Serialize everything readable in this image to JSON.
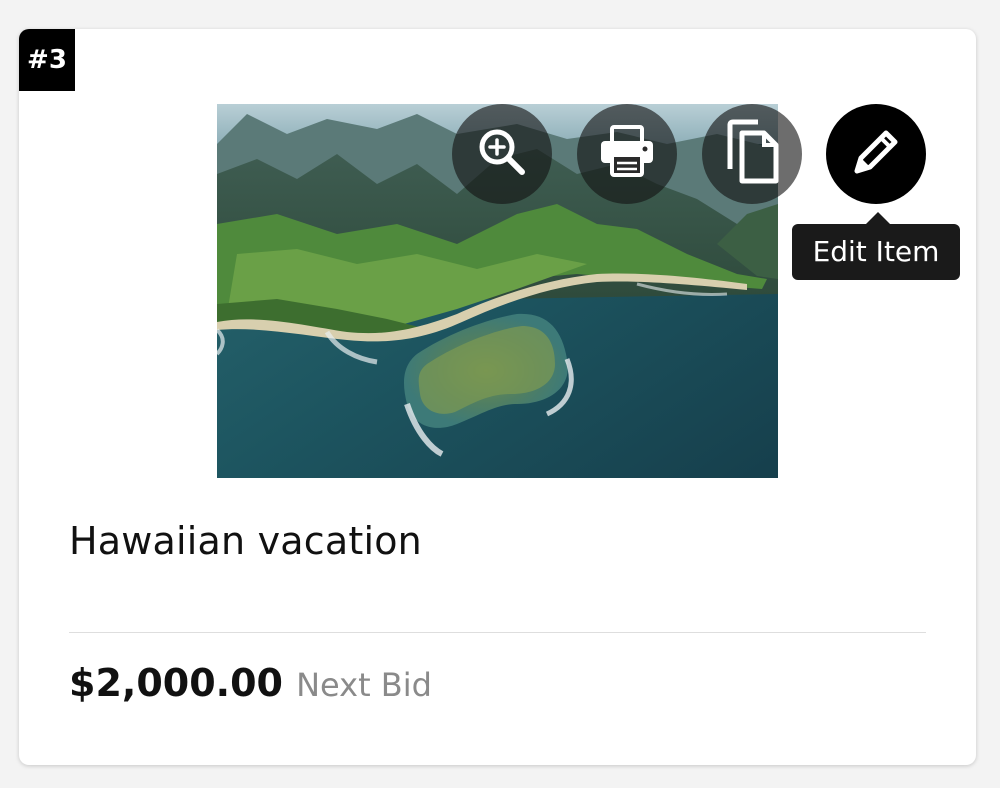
{
  "item": {
    "badge": "#3",
    "title": "Hawaiian vacation",
    "price": "$2,000.00",
    "price_caption": "Next Bid"
  },
  "actions": [
    {
      "icon": "zoom-in-icon",
      "style": "dim"
    },
    {
      "icon": "print-icon",
      "style": "dim"
    },
    {
      "icon": "copy-icon",
      "style": "dim"
    },
    {
      "icon": "pencil-icon",
      "style": "solid"
    }
  ],
  "tooltip": {
    "text": "Edit Item"
  },
  "colors": {
    "badge_bg": "#000000",
    "tooltip_bg": "#1a1a1a",
    "caption_gray": "#8a8a8a"
  }
}
